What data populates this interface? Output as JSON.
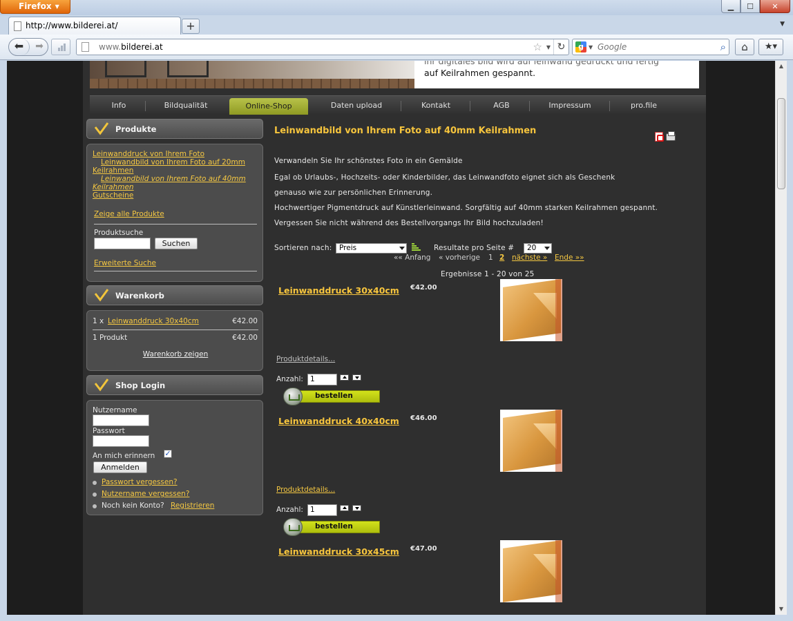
{
  "browser": {
    "app_button": "Firefox",
    "tab_title": "http://www.bilderei.at/",
    "url_prefix": "www.",
    "url_domain": "bilderei.at",
    "search_placeholder": "Google"
  },
  "banner": {
    "line1": "ihr digitales bild wird auf leinwand gedruckt und fertig",
    "line2": "auf Keilrahmen gespannt."
  },
  "nav": [
    "Info",
    "Bildqualität",
    "Online-Shop",
    "Daten upload",
    "Kontakt",
    "AGB",
    "Impressum",
    "pro.file"
  ],
  "nav_active": "Online-Shop",
  "sidebar": {
    "produkte": {
      "title": "Produkte",
      "links": [
        "Leinwanddruck von Ihrem Foto",
        "Leinwandbild von Ihrem Foto auf 20mm",
        "Keilrahmen",
        "Leinwandbild von Ihrem Foto auf 40mm",
        "Keilrahmen",
        "Gutscheine"
      ],
      "show_all": "Zeige alle Produkte",
      "search_label": "Produktsuche",
      "search_button": "Suchen",
      "advanced_search": "Erweiterte Suche"
    },
    "warenkorb": {
      "title": "Warenkorb",
      "qty_prefix": "1 x",
      "item_name": "Leinwanddruck 30x40cm",
      "item_price": "€42.00",
      "summary_label": "1 Produkt",
      "summary_price": "€42.00",
      "show_cart": "Warenkorb zeigen"
    },
    "login": {
      "title": "Shop Login",
      "username_label": "Nutzername",
      "password_label": "Passwort",
      "remember_label": "An mich erinnern",
      "login_button": "Anmelden",
      "forgot_password": "Passwort vergessen?",
      "forgot_username": "Nutzername vergessen?",
      "no_account": "Noch kein Konto?",
      "register": "Registrieren"
    }
  },
  "content": {
    "heading": "Leinwandbild von Ihrem Foto auf 40mm Keilrahmen",
    "paragraphs": [
      "Verwandeln Sie Ihr schönstes Foto in ein Gemälde",
      "Egal ob Urlaubs-, Hochzeits- oder Kinderbilder, das Leinwandfoto eignet sich als Geschenk",
      "genauso wie zur persönlichen Erinnerung.",
      "Hochwertiger Pigmentdruck auf Künstlerleinwand. Sorgfältig auf 40mm starken Keilrahmen gespannt.",
      "Vergessen Sie nicht während des Bestellvorgangs Ihr Bild hochzuladen!"
    ],
    "sort_label": "Sortieren nach:",
    "sort_value": "Preis",
    "per_page_label": "Resultate pro Seite #",
    "per_page_value": "20",
    "pager": {
      "first": "«« Anfang",
      "prev": "« vorherige",
      "page1": "1",
      "page2": "2",
      "next": "nächste »",
      "last": "Ende »»"
    },
    "results": "Ergebnisse 1 - 20 von 25",
    "details_link": "Produktdetails...",
    "qty_label": "Anzahl:",
    "qty_value": "1",
    "order_button": "bestellen",
    "products": [
      {
        "name": "Leinwanddruck 30x40cm",
        "price": "€42.00"
      },
      {
        "name": "Leinwanddruck 40x40cm",
        "price": "€46.00"
      },
      {
        "name": "Leinwanddruck 30x45cm",
        "price": "€47.00"
      }
    ]
  }
}
